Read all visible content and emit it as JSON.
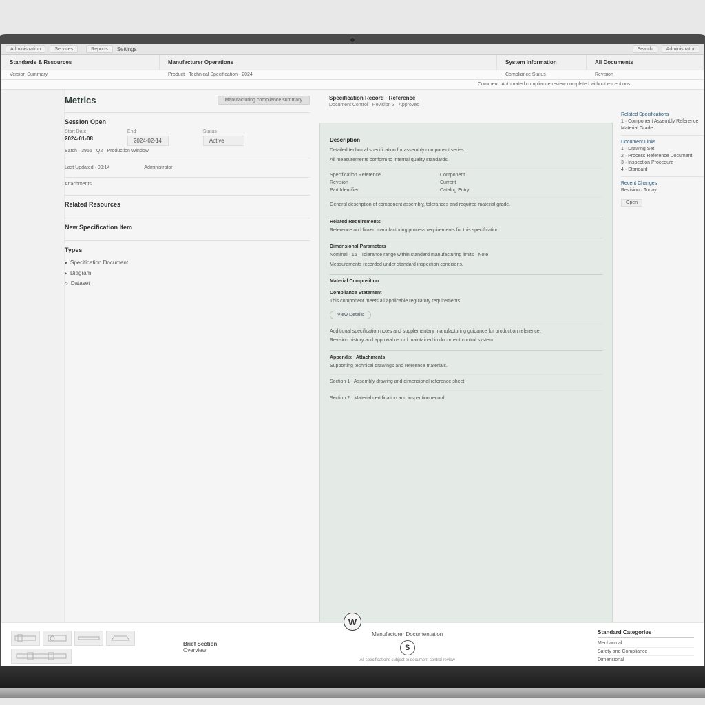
{
  "topbar": {
    "t1": "Administration",
    "t2": "Services",
    "t3": "Reports",
    "t4": "Settings",
    "search": "Search",
    "user": "Administrator"
  },
  "tb2": [
    {
      "title": "Standards & Resources"
    },
    {
      "title": "Manufacturer Operations"
    },
    {
      "title": "System Information",
      "sub": ""
    },
    {
      "title": "All Documents"
    }
  ],
  "tb3": {
    "c1": "Version Summary",
    "c2": "Product · Technical Specification · 2024",
    "c3": "Compliance Status",
    "c4": "Revision"
  },
  "tb4": {
    "r1": "Comment:",
    "r2": "Automated compliance review completed without exceptions."
  },
  "page": {
    "title": "Metrics",
    "pill": "Manufacturing compliance summary"
  },
  "panel1": {
    "title": "Session Open",
    "f1l": "Start Date",
    "f1v": "2024-01-08",
    "f2l": "End",
    "f2v": "2024-02-14",
    "f3l": "Status",
    "f3v": "Active",
    "line1": "Batch · 3956 · Q2 · Production Window",
    "line2": "Last Updated · 09:14",
    "line2b": "Administrator",
    "line3": "Attachments"
  },
  "panel2": {
    "title": "Related Resources"
  },
  "panel3": {
    "title": "New Specification Item"
  },
  "types": {
    "title": "Types",
    "items": [
      "Specification Document",
      "Diagram",
      "Dataset"
    ]
  },
  "dochead": {
    "h1": "Specification Record · Reference",
    "h2": "Document Control · Revision 3 · Approved"
  },
  "doc": {
    "s0": "Description",
    "p0": "Detailed technical specification for assembly component series.",
    "p0b": "All measurements conform to internal quality standards.",
    "kv": [
      {
        "k": "Specification Reference",
        "v": "Component"
      },
      {
        "k": "Revision",
        "v": "Current"
      },
      {
        "k": "Part Identifier",
        "v": "Catalog Entry"
      }
    ],
    "p1": "General description of component assembly, tolerances and required material grade.",
    "s1": "Related Requirements",
    "p2": "Reference and linked manufacturing process requirements for this specification.",
    "s2": "Dimensional Parameters",
    "p3": "Nominal · 15 · Tolerance range within standard manufacturing limits · Note",
    "p3b": "Measurements recorded under standard inspection conditions.",
    "s3": "Material Composition",
    "s4": "Compliance Statement",
    "p4": "This component meets all applicable regulatory requirements.",
    "btn": "View Details",
    "p5": "Additional specification notes and supplementary manufacturing guidance for production reference.",
    "p5b": "Revision history and approval record maintained in document control system.",
    "s5": "Appendix · Attachments",
    "p6": "Supporting technical drawings and reference materials.",
    "p7": "Section 1 · Assembly drawing and dimensional reference sheet.",
    "p8": "Section 2 · Material certification and inspection record."
  },
  "aside": {
    "h1": "Related Specifications",
    "a1": "1 · Component Assembly Reference",
    "a2": "Material Grade",
    "h2": "Document Links",
    "b1": "1 · Drawing Set",
    "b2": "2 · Process Reference Document",
    "b3": "3 · Inspection Procedure",
    "b4": "4 · Standard",
    "h3": "Recent Changes",
    "c1": "Revision · Today",
    "pill": "Open"
  },
  "footer": {
    "left_b": "Brief Section",
    "left_s": "Overview",
    "center": "Manufacturer Documentation",
    "center2": "All specifications subject to document control review",
    "right_h": "Standard Categories",
    "rows": [
      "Mechanical",
      "Safety and Compliance",
      "Dimensional"
    ]
  }
}
